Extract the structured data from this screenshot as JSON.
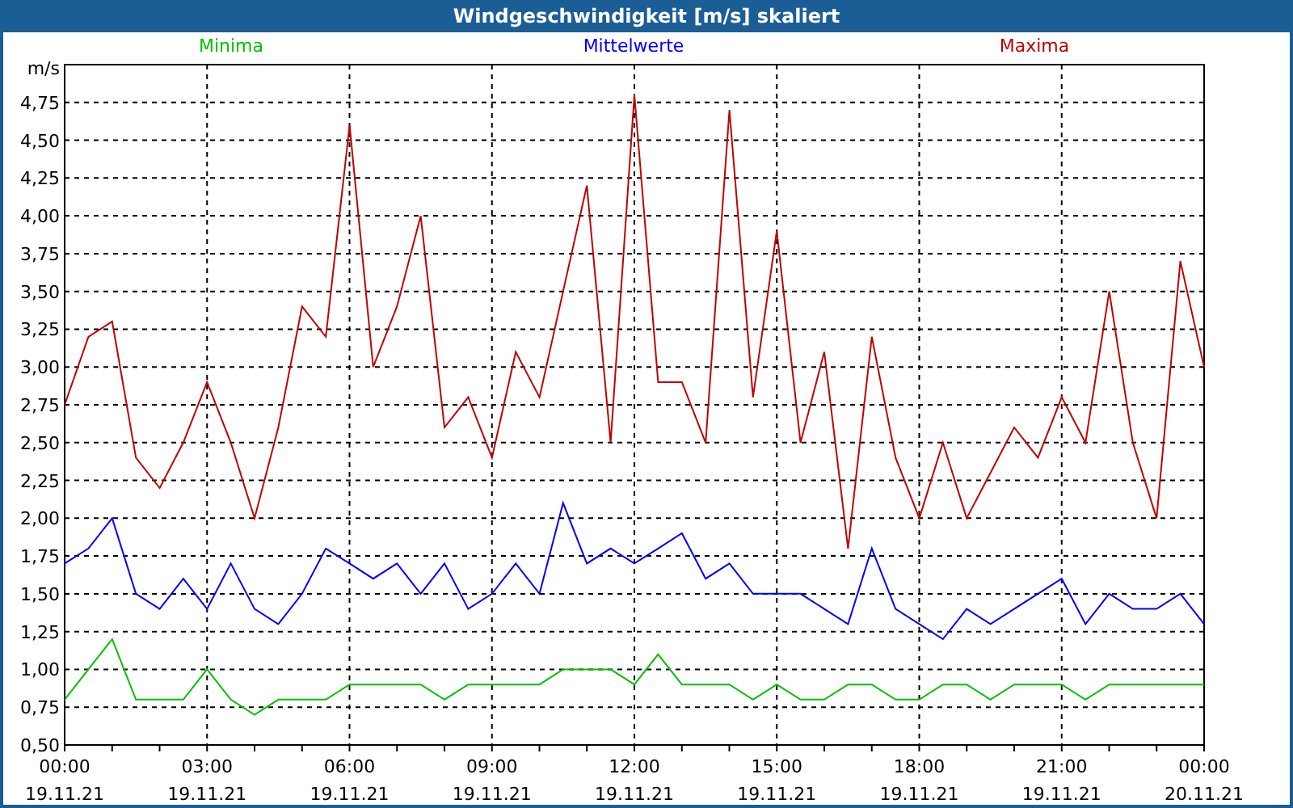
{
  "window": {
    "title": "Windgeschwindigkeit [m/s] skaliert"
  },
  "chart": {
    "chart_data": {
      "type": "line",
      "grid": true,
      "ylabel": "m/s",
      "xlim": [
        0,
        24
      ],
      "ylim": [
        0.5,
        5.0
      ],
      "x": [
        0,
        0.5,
        1,
        1.5,
        2,
        2.5,
        3,
        3.5,
        4,
        4.5,
        5,
        5.5,
        6,
        6.5,
        7,
        7.5,
        8,
        8.5,
        9,
        9.5,
        10,
        10.5,
        11,
        11.5,
        12,
        12.5,
        13,
        13.5,
        14,
        14.5,
        15,
        15.5,
        16,
        16.5,
        17,
        17.5,
        18,
        18.5,
        19,
        19.5,
        20,
        20.5,
        21,
        21.5,
        22,
        22.5,
        23,
        23.5,
        24
      ],
      "series": [
        {
          "name": "Minima",
          "color": "#00c000",
          "values": [
            0.8,
            1.0,
            1.2,
            0.8,
            0.8,
            0.8,
            1.0,
            0.8,
            0.7,
            0.8,
            0.8,
            0.8,
            0.9,
            0.9,
            0.9,
            0.9,
            0.8,
            0.9,
            0.9,
            0.9,
            0.9,
            1.0,
            1.0,
            1.0,
            0.9,
            1.1,
            0.9,
            0.9,
            0.9,
            0.8,
            0.9,
            0.8,
            0.8,
            0.9,
            0.9,
            0.8,
            0.8,
            0.9,
            0.9,
            0.8,
            0.9,
            0.9,
            0.9,
            0.8,
            0.9,
            0.9,
            0.9,
            0.9,
            0.9
          ]
        },
        {
          "name": "Mittelwerte",
          "color": "#0000ff",
          "values": [
            1.7,
            1.8,
            2.0,
            1.5,
            1.4,
            1.6,
            1.4,
            1.7,
            1.4,
            1.3,
            1.5,
            1.8,
            1.7,
            1.6,
            1.7,
            1.5,
            1.7,
            1.4,
            1.5,
            1.7,
            1.5,
            2.1,
            1.7,
            1.8,
            1.7,
            1.8,
            1.9,
            1.6,
            1.7,
            1.5,
            1.5,
            1.5,
            1.4,
            1.3,
            1.8,
            1.4,
            1.3,
            1.2,
            1.4,
            1.3,
            1.4,
            1.5,
            1.6,
            1.3,
            1.5,
            1.4,
            1.4,
            1.5,
            1.3
          ]
        },
        {
          "name": "Maxima",
          "color": "#c00000",
          "values": [
            2.75,
            3.2,
            3.3,
            2.4,
            2.2,
            2.5,
            2.9,
            2.5,
            2.0,
            2.6,
            3.4,
            3.2,
            4.6,
            3.0,
            3.4,
            4.0,
            2.6,
            2.8,
            2.4,
            3.1,
            2.8,
            3.5,
            4.2,
            2.5,
            4.8,
            2.9,
            2.9,
            2.5,
            4.7,
            2.8,
            3.9,
            2.5,
            3.1,
            1.8,
            3.2,
            2.4,
            2.0,
            2.5,
            2.0,
            2.3,
            2.6,
            2.4,
            2.8,
            2.5,
            3.5,
            2.5,
            2.0,
            3.7,
            3.0
          ]
        }
      ],
      "yticks": [
        {
          "value": 0.5,
          "label": "0,50"
        },
        {
          "value": 0.75,
          "label": "0,75"
        },
        {
          "value": 1.0,
          "label": "1,00"
        },
        {
          "value": 1.25,
          "label": "1,25"
        },
        {
          "value": 1.5,
          "label": "1,50"
        },
        {
          "value": 1.75,
          "label": "1,75"
        },
        {
          "value": 2.0,
          "label": "2,00"
        },
        {
          "value": 2.25,
          "label": "2,25"
        },
        {
          "value": 2.5,
          "label": "2,50"
        },
        {
          "value": 2.75,
          "label": "2,75"
        },
        {
          "value": 3.0,
          "label": "3,00"
        },
        {
          "value": 3.25,
          "label": "3,25"
        },
        {
          "value": 3.5,
          "label": "3,50"
        },
        {
          "value": 3.75,
          "label": "3,75"
        },
        {
          "value": 4.0,
          "label": "4,00"
        },
        {
          "value": 4.25,
          "label": "4,25"
        },
        {
          "value": 4.5,
          "label": "4,50"
        },
        {
          "value": 4.75,
          "label": "4,75"
        }
      ],
      "xticks": [
        {
          "value": 0,
          "label": "00:00"
        },
        {
          "value": 3,
          "label": "03:00"
        },
        {
          "value": 6,
          "label": "06:00"
        },
        {
          "value": 9,
          "label": "09:00"
        },
        {
          "value": 12,
          "label": "12:00"
        },
        {
          "value": 15,
          "label": "15:00"
        },
        {
          "value": 18,
          "label": "18:00"
        },
        {
          "value": 21,
          "label": "21:00"
        },
        {
          "value": 24,
          "label": "00:00"
        }
      ]
    },
    "xtick_dates": [
      "19.11.21",
      "19.11.21",
      "19.11.21",
      "19.11.21",
      "19.11.21",
      "19.11.21",
      "19.11.21",
      "19.11.21",
      "20.11.21"
    ]
  }
}
